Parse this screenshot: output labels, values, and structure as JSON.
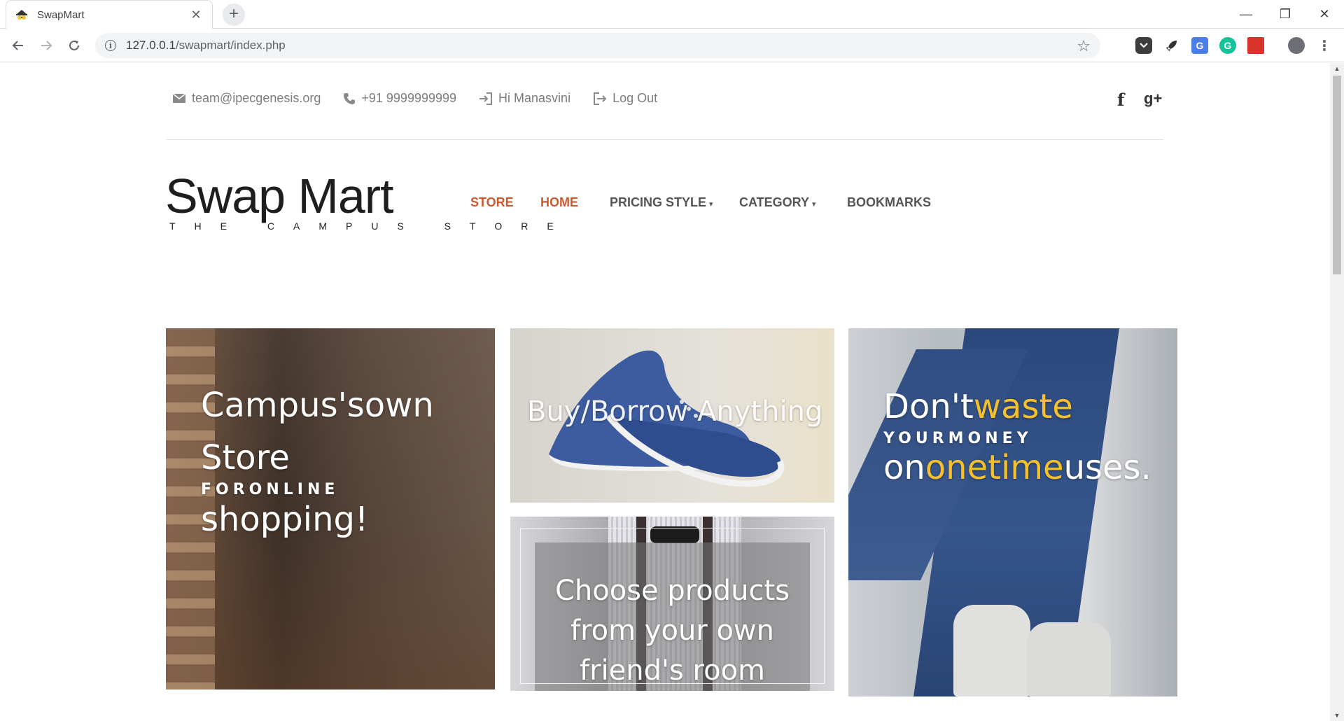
{
  "browser": {
    "tab_title": "SwapMart",
    "url_host": "127.0.0.1",
    "url_path": "/swapmart/index.php",
    "new_tab": "+",
    "close_tab": "✕",
    "minimize": "—",
    "maximize": "❐",
    "close_window": "✕"
  },
  "topbar": {
    "email": "team@ipecgenesis.org",
    "phone": "+91 9999999999",
    "greeting": "Hi Manasvini",
    "logout": "Log Out",
    "facebook": "f",
    "googleplus": "g+"
  },
  "logo": {
    "name": "Swap Mart",
    "tagline": "THE CAMPUS STORE"
  },
  "nav": {
    "store": "STORE",
    "home": "HOME",
    "pricing": "PRICING STYLE",
    "category": "CATEGORY",
    "bookmarks": "BOOKMARKS",
    "caret": "▾"
  },
  "tiles": {
    "campus": {
      "line1": "Campus'sown",
      "line2": "Store",
      "line3": "FORONLINE",
      "line4": "shopping!"
    },
    "buy": {
      "text": "Buy/Borrow Anything"
    },
    "choose": {
      "line1": "Choose products",
      "line2": "from your own",
      "line3": "friend's room"
    },
    "waste": {
      "part1": "Don't",
      "part2": "waste",
      "line2": "YOURMONEY",
      "part3": "on",
      "part4": "onetime",
      "part5": "uses."
    }
  },
  "colors": {
    "accent_yellow": "#f6c02c",
    "nav_active": "#c95a2f",
    "nav_default": "#555555"
  }
}
